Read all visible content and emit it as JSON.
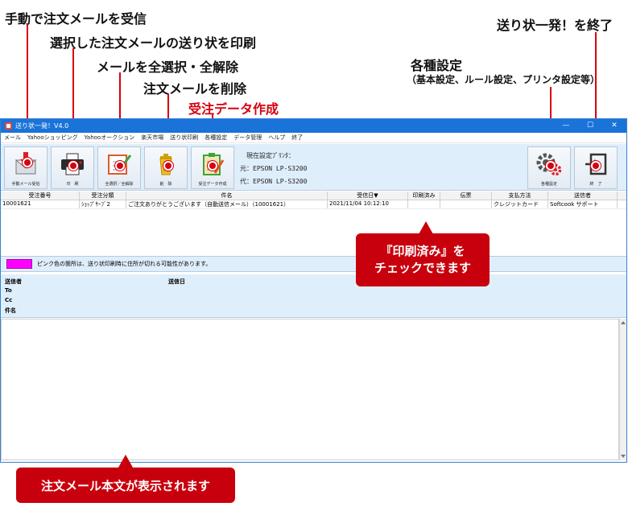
{
  "annotations": {
    "manual_receive": "手動で注文メールを受信",
    "print_selected": "選択した注文メールの送り状を印刷",
    "select_all": "メールを全選択・全解除",
    "delete_mail": "注文メールを削除",
    "create_data": "受注データ作成",
    "settings": "各種設定",
    "settings_sub": "（基本設定、ルール設定、プリンタ設定等）",
    "exit": "送り状一発！を終了",
    "printed_check": [
      "『印刷済み』を",
      "チェックできます"
    ],
    "body_shown": "注文メール本文が表示されます"
  },
  "window": {
    "title": "送り状一発！V4.0",
    "controls": [
      "—",
      "☐",
      "✕"
    ]
  },
  "menu": [
    "メール",
    "Yahooショッピング",
    "Yahooオークション",
    "楽天市場",
    "送り状印刷",
    "各種設定",
    "データ管理",
    "ヘルプ",
    "終了"
  ],
  "toolbar": {
    "receive_label": "手動メール受信",
    "print_label": "印　刷",
    "select_all_label": "全選択／全解除",
    "delete_label": "削　除",
    "create_data_label": "受注データ作成",
    "settings_label": "各種設定",
    "exit_label": "終　了",
    "printer_heading": "現在設定ﾌﾟﾘﾝﾀ：",
    "printer_main": "元：EPSON LP-S3200",
    "printer_sub": "代：EPSON LP-S3200"
  },
  "grid": {
    "headers": [
      "受注番号",
      "受注分類",
      "件名",
      "受信日▼",
      "印刷済み",
      "伝票",
      "支払方法",
      "送信者"
    ],
    "rows": [
      [
        "10001621",
        "ｼｮｯﾌﾟｻｰﾌﾞ2",
        "ご注文ありがとうございます（自動送信メール）（10001621）",
        "2021/11/04 10:12:10",
        "",
        "",
        "クレジットカード",
        "Softcook サポート"
      ]
    ]
  },
  "notice": {
    "text": "ピンク色の箇所は、送り状印刷時に住所が切れる可能性があります。",
    "swatch_color": "#ff00ff"
  },
  "mail_header": {
    "sender": "送信者",
    "sent_date": "送信日",
    "to": "To",
    "cc": "Cc",
    "subject": "件名"
  },
  "colors": {
    "accent_red": "#c8000d",
    "titlebar_blue": "#1a73d9",
    "panel_blue": "#dfeefb"
  }
}
